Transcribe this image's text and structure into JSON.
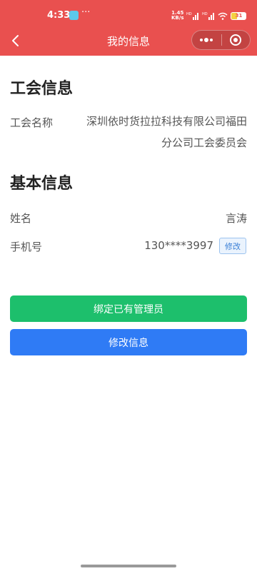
{
  "status_bar": {
    "time": "4:33",
    "dots": "···",
    "speed_value": "1.45",
    "speed_unit": "KB/s",
    "battery": "31"
  },
  "nav": {
    "title": "我的信息",
    "more_icon": "more-dots-icon",
    "close_icon": "target-circle-icon"
  },
  "union_section": {
    "title": "工会信息",
    "name_label": "工会名称",
    "name_value_line1": "深圳依时货拉拉科技有限公司福田",
    "name_value_line2": "分公司工会委员会"
  },
  "basic_section": {
    "title": "基本信息",
    "name_label": "姓名",
    "name_value": "言涛",
    "phone_label": "手机号",
    "phone_value": "130****3997",
    "edit_phone_label": "修改"
  },
  "actions": {
    "bind_admin_label": "绑定已有管理员",
    "edit_info_label": "修改信息"
  },
  "colors": {
    "header": "#e9504f",
    "green_button": "#1dbf6c",
    "blue_button": "#2f7bf5"
  }
}
